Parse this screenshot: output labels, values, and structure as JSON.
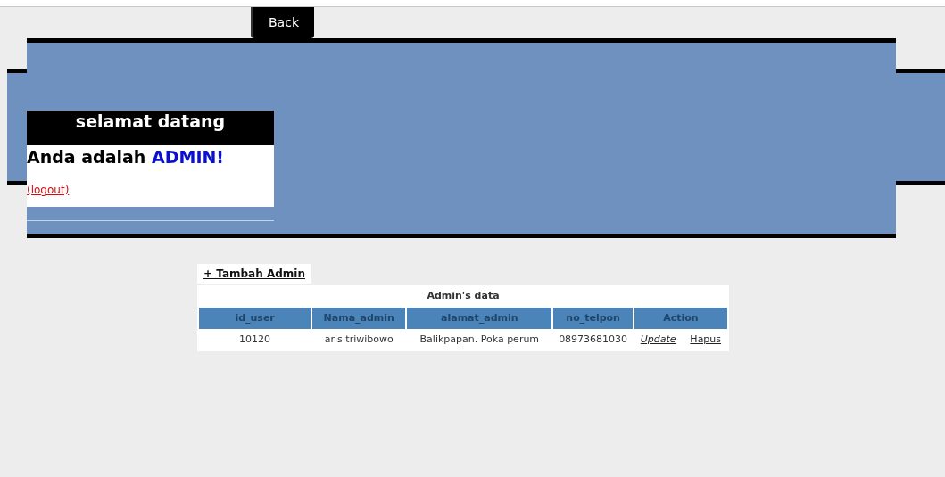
{
  "back_button": "Back",
  "welcome": {
    "title": "selamat datang",
    "message": "Anda adalah **ADMIN!**",
    "logout": "(logout)"
  },
  "add_link": "+ Tambah Admin",
  "table": {
    "caption": "Admin's data",
    "columns": [
      "id_user",
      "Nama_admin",
      "alamat_admin",
      "no_telpon",
      "Action"
    ],
    "rows": [
      {
        "cells": [
          "10120",
          "aris triwibowo",
          "Balikpapan. Poka perum",
          "08973681030"
        ],
        "actions": [
          {
            "label": "Update",
            "kind": "edit"
          },
          {
            "label": "Hapus",
            "kind": "delete"
          }
        ]
      }
    ]
  }
}
